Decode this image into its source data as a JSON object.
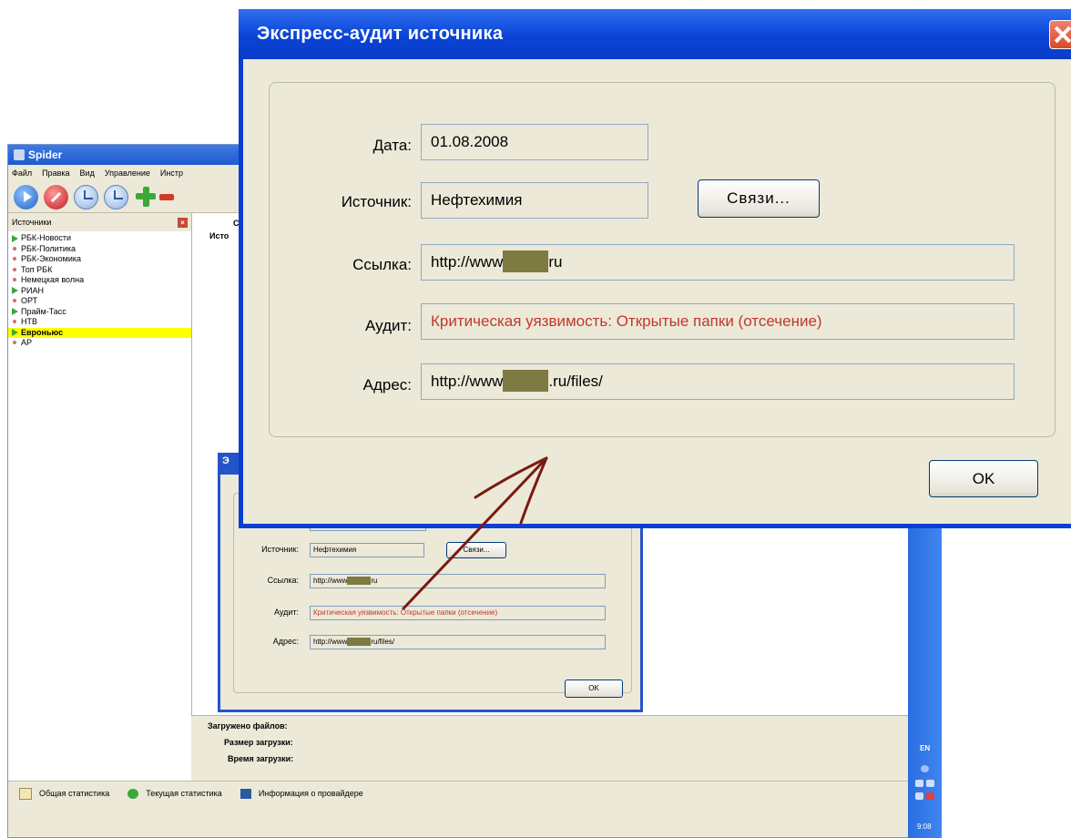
{
  "spider": {
    "title": "Spider",
    "menu": [
      "Файл",
      "Правка",
      "Вид",
      "Управление",
      "Инстр"
    ],
    "left_panel": {
      "header": "Источники",
      "items": [
        {
          "label": "РБК-Новости",
          "marker": "play"
        },
        {
          "label": "РБК-Политика",
          "marker": "dot"
        },
        {
          "label": "РБК-Экономика",
          "marker": "dot"
        },
        {
          "label": "Топ РБК",
          "marker": "dot"
        },
        {
          "label": "Немецкая волна",
          "marker": "dot"
        },
        {
          "label": "РИАН",
          "marker": "play"
        },
        {
          "label": "ОРТ",
          "marker": "dot"
        },
        {
          "label": "Прайм-Тасс",
          "marker": "play"
        },
        {
          "label": "НТВ",
          "marker": "dot"
        },
        {
          "label": "Евроньюс",
          "marker": "play",
          "selected": true
        },
        {
          "label": "AP",
          "marker": "dot"
        }
      ]
    },
    "right_header": {
      "col1": "С",
      "col2": "Исто"
    },
    "bottom_panel": {
      "loaded_files": "Загружено файлов:",
      "load_size": "Размер загрузки:",
      "load_time": "Время загрузки:"
    },
    "status_tabs": [
      "Общая статистика",
      "Текущая статистика",
      "Информация о провайдере"
    ]
  },
  "taskbar": {
    "lang": "EN",
    "clock": "9:08"
  },
  "small_dialog": {
    "title": "Э",
    "source_label": "Источник:",
    "source_value": "Нефтехимия",
    "links_button": "Связи...",
    "link_label": "Ссылка:",
    "link_value_pre": "http://www",
    "link_value_post": "ru",
    "audit_label": "Аудит:",
    "audit_value": "Критическая уязвимость: Открытые папки (отсечение)",
    "address_label": "Адрес:",
    "address_value_pre": "http://www",
    "address_value_post": "ru/files/",
    "ok_button": "OK"
  },
  "main_dialog": {
    "title": "Экспресс-аудит источника",
    "date_label": "Дата:",
    "date_value": "01.08.2008",
    "source_label": "Источник:",
    "source_value": "Нефтехимия",
    "links_button": "Связи...",
    "link_label": "Ссылка:",
    "link_value_pre": "http://www",
    "link_value_post": "ru",
    "audit_label": "Аудит:",
    "audit_value": "Критическая уязвимость: Открытые папки (отсечение)",
    "address_label": "Адрес:",
    "address_value_pre": "http://www",
    "address_value_post": ".ru/files/",
    "ok_button": "OK"
  },
  "colors": {
    "xp_title_blue": "#0a44d6",
    "dialog_face": "#ece9d8",
    "audit_text_red": "#c0392b",
    "redaction": "#7d7a42",
    "arrow": "#7a1a12",
    "selection_yellow": "#ffff00"
  }
}
